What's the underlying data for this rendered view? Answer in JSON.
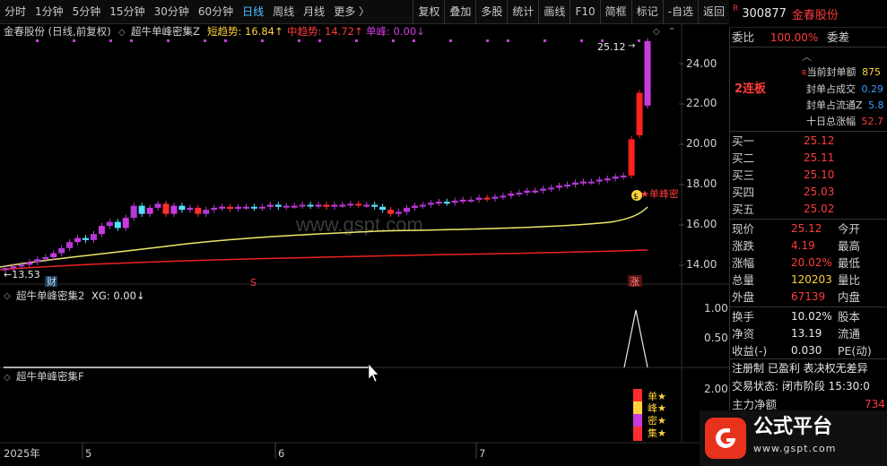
{
  "toolbar": {
    "left": [
      "分时",
      "1分钟",
      "5分钟",
      "15分钟",
      "30分钟",
      "60分钟",
      "日线",
      "周线",
      "月线",
      "更多 〉"
    ],
    "active_index": 6,
    "right": [
      "复权",
      "叠加",
      "多股",
      "统计",
      "画线",
      "F10",
      "简框",
      "标记",
      "-自选",
      "返回"
    ]
  },
  "stock": {
    "badge": "R",
    "code": "300877",
    "name": "金春股份"
  },
  "main_panel": {
    "title": "金春股份 (日线,前复权)",
    "indicator": "超牛单峰密集Z",
    "short_trend": "短趋势: 16.84↑",
    "mid_trend": "中趋势: 14.72↑",
    "peak": "单峰: 0.00↓",
    "price_ticks": [
      "24.00",
      "22.00",
      "20.00",
      "18.00",
      "16.00",
      "14.00"
    ],
    "high_label": "25.12",
    "low_label": "←13.53",
    "signal_label": "★单峰密",
    "marks": {
      "cai": "财",
      "s": "S",
      "zhang": "涨",
      "dollar": "$"
    }
  },
  "panel2": {
    "title": "超牛单峰密集2",
    "value": "XG: 0.00↓",
    "ticks": [
      "1.00",
      "0.50"
    ]
  },
  "panel3": {
    "title": "超牛单峰密集F",
    "ticks": [
      "2.00"
    ],
    "badges": [
      "单★",
      "峰★",
      "密★",
      "集★"
    ]
  },
  "xaxis": [
    "2025年",
    "5",
    "6",
    "7"
  ],
  "chart_data": {
    "type": "candlestick",
    "title": "金春股份 (日线,前复权)",
    "y_ticks": [
      14,
      16,
      18,
      20,
      22,
      24
    ],
    "ylim": [
      13.1,
      26.0
    ],
    "x_ticks": [
      "2025年",
      "5",
      "6",
      "7"
    ],
    "last_close": 25.12,
    "period_low": 13.53,
    "series": [
      {
        "name": "短趋势",
        "value": 16.84
      },
      {
        "name": "中趋势",
        "value": 14.72
      },
      {
        "name": "单峰",
        "value": 0.0
      }
    ]
  },
  "quote": {
    "weibi_label": "委比",
    "weibi": "100.00%",
    "weicha_label": "委差",
    "limit_labels": [
      "当前封单额",
      "封单占成交",
      "封单占流通Z",
      "十日总涨幅"
    ],
    "limit_values": [
      "875",
      "0.29",
      "5.8",
      "52.7"
    ],
    "streak": "2连板",
    "bids": [
      {
        "label": "买一",
        "price": "25.12"
      },
      {
        "label": "买二",
        "price": "25.11"
      },
      {
        "label": "买三",
        "price": "25.10"
      },
      {
        "label": "买四",
        "price": "25.03"
      },
      {
        "label": "买五",
        "price": "25.02"
      }
    ],
    "stats": [
      {
        "l1": "现价",
        "v1": "25.12",
        "l2": "今开"
      },
      {
        "l1": "涨跌",
        "v1": "4.19",
        "l2": "最高"
      },
      {
        "l1": "涨幅",
        "v1": "20.02%",
        "l2": "最低"
      },
      {
        "l1": "总量",
        "v1": "120203",
        "l2": "量比"
      },
      {
        "l1": "外盘",
        "v1": "67139",
        "l2": "内盘"
      }
    ],
    "stats2": [
      {
        "l1": "换手",
        "v1": "10.02%",
        "l2": "股本"
      },
      {
        "l1": "净资",
        "v1": "13.19",
        "l2": "流通"
      },
      {
        "l1": "收益(-)",
        "v1": "0.030",
        "l2": "PE(动)"
      }
    ],
    "tags": "注册制 已盈利 表决权无差异",
    "trade_status": "交易状态: 闭市阶段 15:30:0",
    "main_flow_label": "主力净额",
    "main_flow_value": "734"
  },
  "brand": {
    "name": "公式平台",
    "url": "www.gspt.com"
  },
  "watermark": "www.gspt.com"
}
